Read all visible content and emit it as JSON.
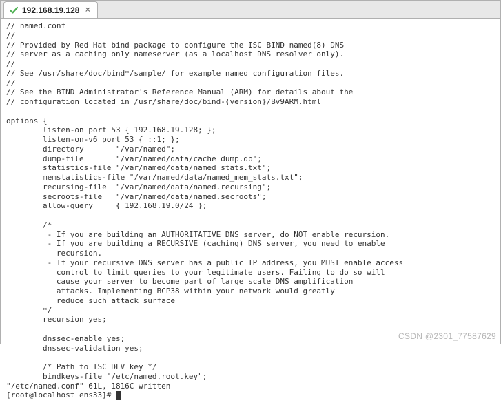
{
  "tab": {
    "label": "192.168.19.128",
    "status": "connected"
  },
  "terminal": {
    "content": "// named.conf\n//\n// Provided by Red Hat bind package to configure the ISC BIND named(8) DNS\n// server as a caching only nameserver (as a localhost DNS resolver only).\n//\n// See /usr/share/doc/bind*/sample/ for example named configuration files.\n//\n// See the BIND Administrator's Reference Manual (ARM) for details about the\n// configuration located in /usr/share/doc/bind-{version}/Bv9ARM.html\n\noptions {\n        listen-on port 53 { 192.168.19.128; };\n        listen-on-v6 port 53 { ::1; };\n        directory       \"/var/named\";\n        dump-file       \"/var/named/data/cache_dump.db\";\n        statistics-file \"/var/named/data/named_stats.txt\";\n        memstatistics-file \"/var/named/data/named_mem_stats.txt\";\n        recursing-file  \"/var/named/data/named.recursing\";\n        secroots-file   \"/var/named/data/named.secroots\";\n        allow-query     { 192.168.19.0/24 };\n\n        /*\n         - If you are building an AUTHORITATIVE DNS server, do NOT enable recursion.\n         - If you are building a RECURSIVE (caching) DNS server, you need to enable\n           recursion.\n         - If your recursive DNS server has a public IP address, you MUST enable access\n           control to limit queries to your legitimate users. Failing to do so will\n           cause your server to become part of large scale DNS amplification\n           attacks. Implementing BCP38 within your network would greatly\n           reduce such attack surface\n        */\n        recursion yes;\n\n        dnssec-enable yes;\n        dnssec-validation yes;\n\n        /* Path to ISC DLV key */\n        bindkeys-file \"/etc/named.root.key\";",
    "status_line": "\"/etc/named.conf\" 61L, 1816C written",
    "prompt": "[root@localhost ens33]# "
  },
  "watermark": "CSDN @2301_77587629"
}
